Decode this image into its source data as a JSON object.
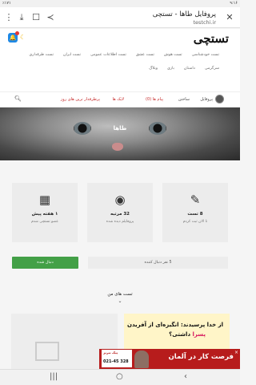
{
  "statusbar": {
    "time": "۹:۱۶",
    "battery": "٪۱۷۱"
  },
  "browser": {
    "title": "پروفایل طاها - تستچی",
    "url": "testchi.ir",
    "close_icon": "close-icon",
    "share_icon": "share-icon",
    "bookmark_icon": "bookmark-icon",
    "download_icon": "download-icon",
    "menu_icon": "more-vert-icon"
  },
  "header": {
    "logo": "تستچی",
    "category_links": [
      "تست خودشناسی",
      "تست هوش",
      "تست عشق",
      "تست اطلاعات عمومی",
      "تست ایران",
      "تست طرفداری",
      "سرگرمی",
      "داستان",
      "بازی",
      "وبلاگ"
    ]
  },
  "navbar": {
    "profile_label": "پروفایل",
    "settings_label": "ساختن",
    "messages_label": "پیام ها (0)",
    "likes_label": "لایک ها",
    "popular_label": "پرطرفدار ترین های روز"
  },
  "cover": {
    "name": "طاها"
  },
  "cards": [
    {
      "icon": "calendar-icon",
      "title": "۱ هفته پیش",
      "sub": "عضو تستچی شدم"
    },
    {
      "icon": "eye-icon",
      "title": "32 مرتبه",
      "sub": "پروفایلم دیده شده"
    },
    {
      "icon": "pencil-icon",
      "title": "8 تست",
      "sub": "تا الان ثبت کردم"
    }
  ],
  "followers": "5 نفر دنبال کننده",
  "follow_button": "دنبال شده",
  "section_title": "تست های من",
  "thumb": {
    "line1": "از خدا پرسیدند: انگیزه‌ای از آفریدن",
    "line2_prefix": "",
    "line2_highlight": "پسرا",
    "line2_suffix": " داشتی؟"
  },
  "ad": {
    "text": "فرصت کار در آلمان",
    "brand": "پیک تبریز",
    "phone": "021-45 328",
    "close": "×"
  },
  "bottom_nav": {
    "recents": "|||",
    "home": "○",
    "back": "‹"
  }
}
